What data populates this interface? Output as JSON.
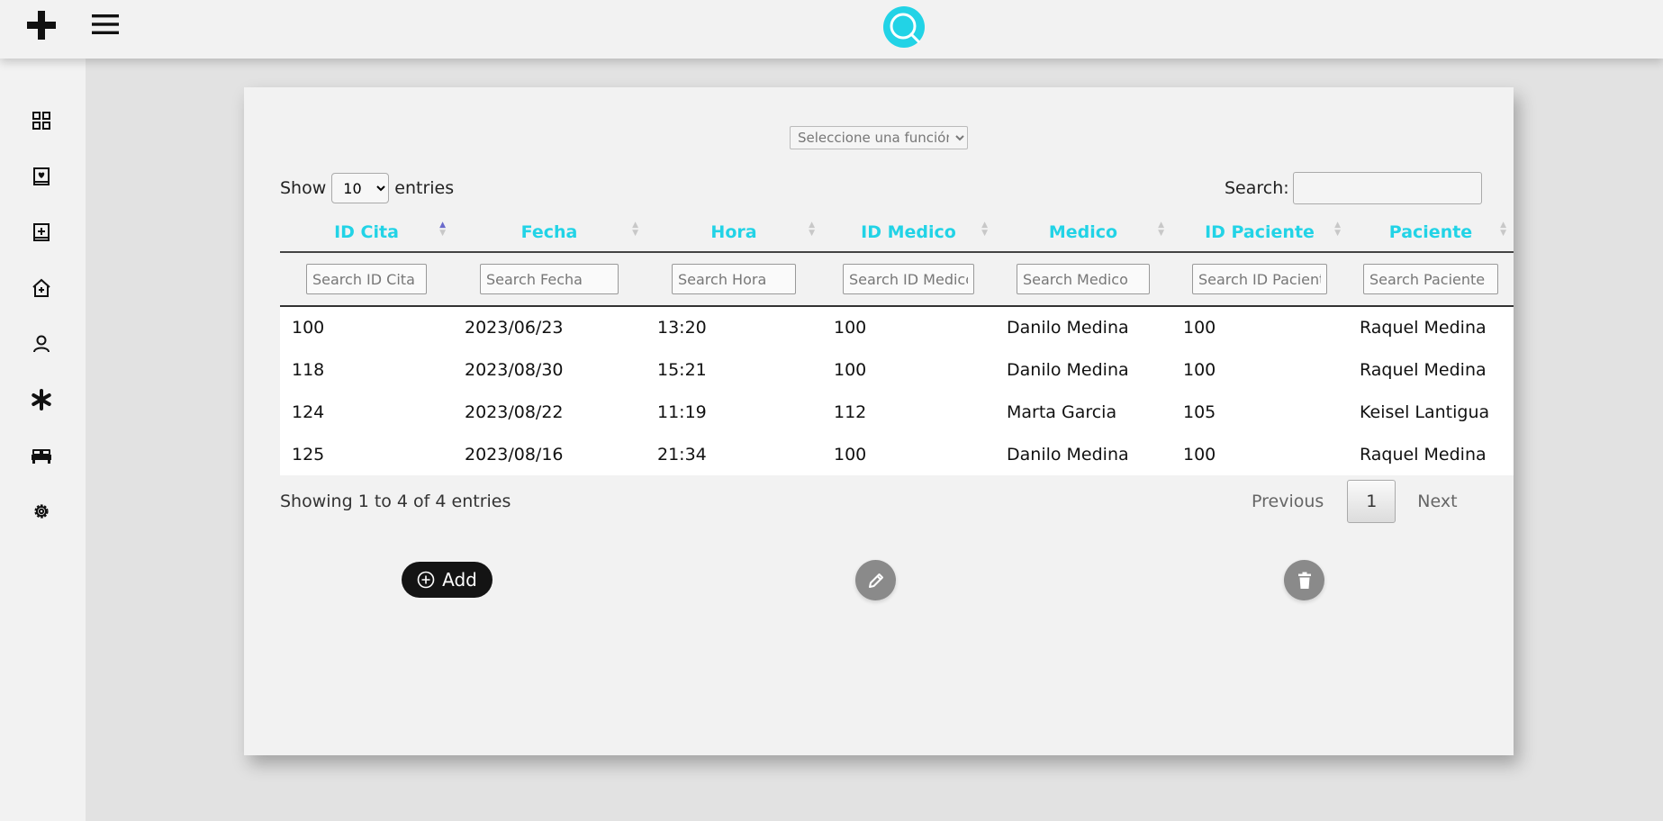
{
  "topbar": {
    "brand_icon": "plus-cross-icon",
    "menu_icon": "hamburger-menu-icon",
    "logo_icon": "search-logo-icon",
    "logo_color": "#22d3e6"
  },
  "sidebar": {
    "items": [
      {
        "icon": "dashboard-grid-icon"
      },
      {
        "icon": "medical-history-icon"
      },
      {
        "icon": "medical-book-icon"
      },
      {
        "icon": "home-health-icon"
      },
      {
        "icon": "user-icon"
      },
      {
        "icon": "asterisk-icon"
      },
      {
        "icon": "bed-icon"
      },
      {
        "icon": "gear-icon"
      }
    ]
  },
  "function_select": {
    "selected": "Seleccione una función"
  },
  "length": {
    "show_label": "Show",
    "value": "10",
    "entries_label": "entries"
  },
  "search": {
    "label": "Search:",
    "value": ""
  },
  "table": {
    "columns": [
      {
        "label": "ID Cita",
        "placeholder": "Search ID Cita"
      },
      {
        "label": "Fecha",
        "placeholder": "Search Fecha"
      },
      {
        "label": "Hora",
        "placeholder": "Search Hora"
      },
      {
        "label": "ID Medico",
        "placeholder": "Search ID Medico"
      },
      {
        "label": "Medico",
        "placeholder": "Search Medico"
      },
      {
        "label": "ID Paciente",
        "placeholder": "Search ID Paciente"
      },
      {
        "label": "Paciente",
        "placeholder": "Search Paciente"
      }
    ],
    "rows": [
      [
        "100",
        "2023/06/23",
        "13:20",
        "100",
        "Danilo Medina",
        "100",
        "Raquel Medina"
      ],
      [
        "118",
        "2023/08/30",
        "15:21",
        "100",
        "Danilo Medina",
        "100",
        "Raquel Medina"
      ],
      [
        "124",
        "2023/08/22",
        "11:19",
        "112",
        "Marta Garcia",
        "105",
        "Keisel Lantigua"
      ],
      [
        "125",
        "2023/08/16",
        "21:34",
        "100",
        "Danilo Medina",
        "100",
        "Raquel Medina"
      ]
    ]
  },
  "info": "Showing 1 to 4 of 4 entries",
  "pagination": {
    "previous": "Previous",
    "page": "1",
    "next": "Next"
  },
  "actions": {
    "add_label": "Add",
    "add_icon": "plus-circle-icon",
    "edit_icon": "pencil-icon",
    "delete_icon": "trash-icon"
  },
  "colors": {
    "accent": "#22d3e6",
    "header_text": "#22d3e6",
    "add_button": "#141414",
    "icon_button": "#8a8a8a"
  }
}
